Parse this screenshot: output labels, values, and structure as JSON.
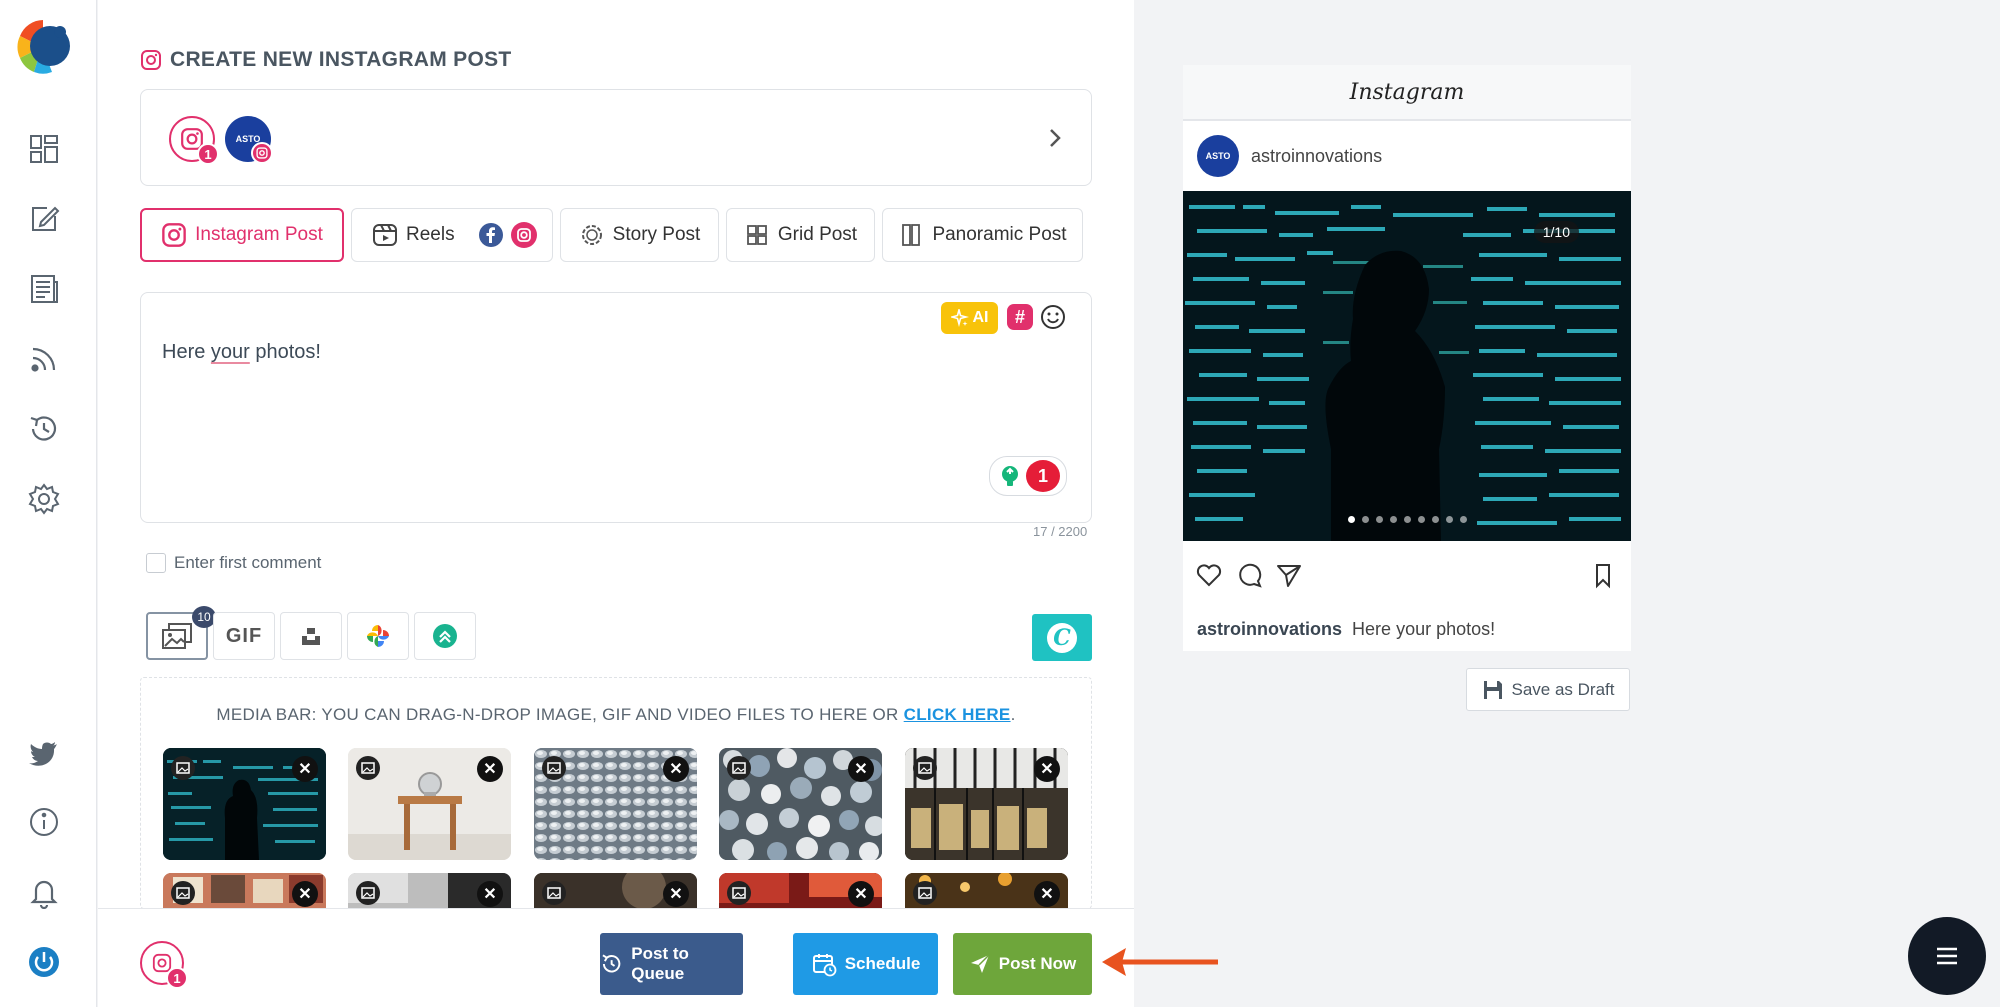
{
  "page": {
    "title": "CREATE NEW INSTAGRAM POST"
  },
  "accounts": {
    "instagram_count": "1",
    "brand_avatar_text": "ASTO"
  },
  "tabs": [
    {
      "label": "Instagram Post",
      "icon": "instagram-icon",
      "active": true
    },
    {
      "label": "Reels",
      "icon": "reels-icon",
      "active": false
    },
    {
      "label": "Story Post",
      "icon": "story-icon",
      "active": false
    },
    {
      "label": "Grid Post",
      "icon": "grid-icon",
      "active": false
    },
    {
      "label": "Panoramic Post",
      "icon": "panoramic-icon",
      "active": false
    }
  ],
  "editor": {
    "text_before": "Here ",
    "text_flagged": "your",
    "text_after": " photos!",
    "ai_label": "AI",
    "hashtag_label": "#",
    "tip_count": "1",
    "char_count": "17 / 2200"
  },
  "first_comment": {
    "label": "Enter first comment"
  },
  "media_tools": {
    "media_count": "10",
    "gif_label": "GIF",
    "canva_label": "C"
  },
  "media_bar": {
    "hint": "MEDIA BAR: YOU CAN DRAG-N-DROP IMAGE, GIF AND VIDEO FILES TO HERE OR ",
    "link": "CLICK HERE",
    "suffix": ".",
    "remove_label": "✕"
  },
  "actions": {
    "queue": "Post to Queue",
    "schedule": "Schedule",
    "post_now": "Post Now",
    "account_count": "1"
  },
  "preview": {
    "app_name": "Instagram",
    "username": "astroinnovations",
    "avatar_text": "ASTO",
    "counter": "1/10",
    "caption": "Here your photos!",
    "save_draft": "Save as Draft"
  },
  "colors": {
    "instagram": "#e1306c",
    "queue": "#3b5b8c",
    "schedule": "#1f9ae5",
    "post_now": "#6ea63b",
    "arrow": "#e8531f"
  }
}
